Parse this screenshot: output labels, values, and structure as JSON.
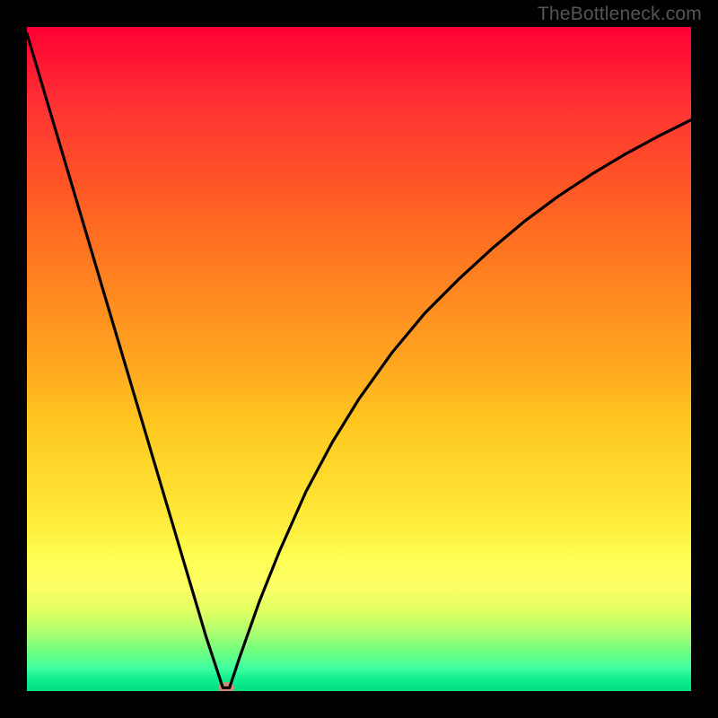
{
  "watermark": {
    "text": "TheBottleneck.com"
  },
  "chart_data": {
    "type": "line",
    "title": "",
    "xlabel": "",
    "ylabel": "",
    "xlim": [
      0,
      100
    ],
    "ylim": [
      0,
      100
    ],
    "x": [
      0,
      3,
      6,
      9,
      12,
      15,
      18,
      21,
      24,
      27,
      29.5,
      30.5,
      32,
      35,
      38,
      42,
      46,
      50,
      55,
      60,
      65,
      70,
      75,
      80,
      85,
      90,
      95,
      100
    ],
    "values": [
      99,
      88.9,
      78.8,
      68.7,
      58.6,
      48.5,
      38.4,
      28.3,
      18.2,
      8.1,
      0.5,
      0.5,
      5.0,
      13.5,
      21.0,
      30.0,
      37.5,
      44.0,
      51.0,
      57.0,
      62.0,
      66.6,
      70.8,
      74.5,
      77.8,
      80.8,
      83.5,
      86.0
    ],
    "marker": {
      "x": 30,
      "y": 0.6,
      "color": "#d18a7a"
    },
    "gradient_stops": [
      {
        "pos": 0,
        "color": "#ff0033"
      },
      {
        "pos": 50,
        "color": "#ffaa20"
      },
      {
        "pos": 80,
        "color": "#ffff55"
      },
      {
        "pos": 100,
        "color": "#00e080"
      }
    ]
  }
}
